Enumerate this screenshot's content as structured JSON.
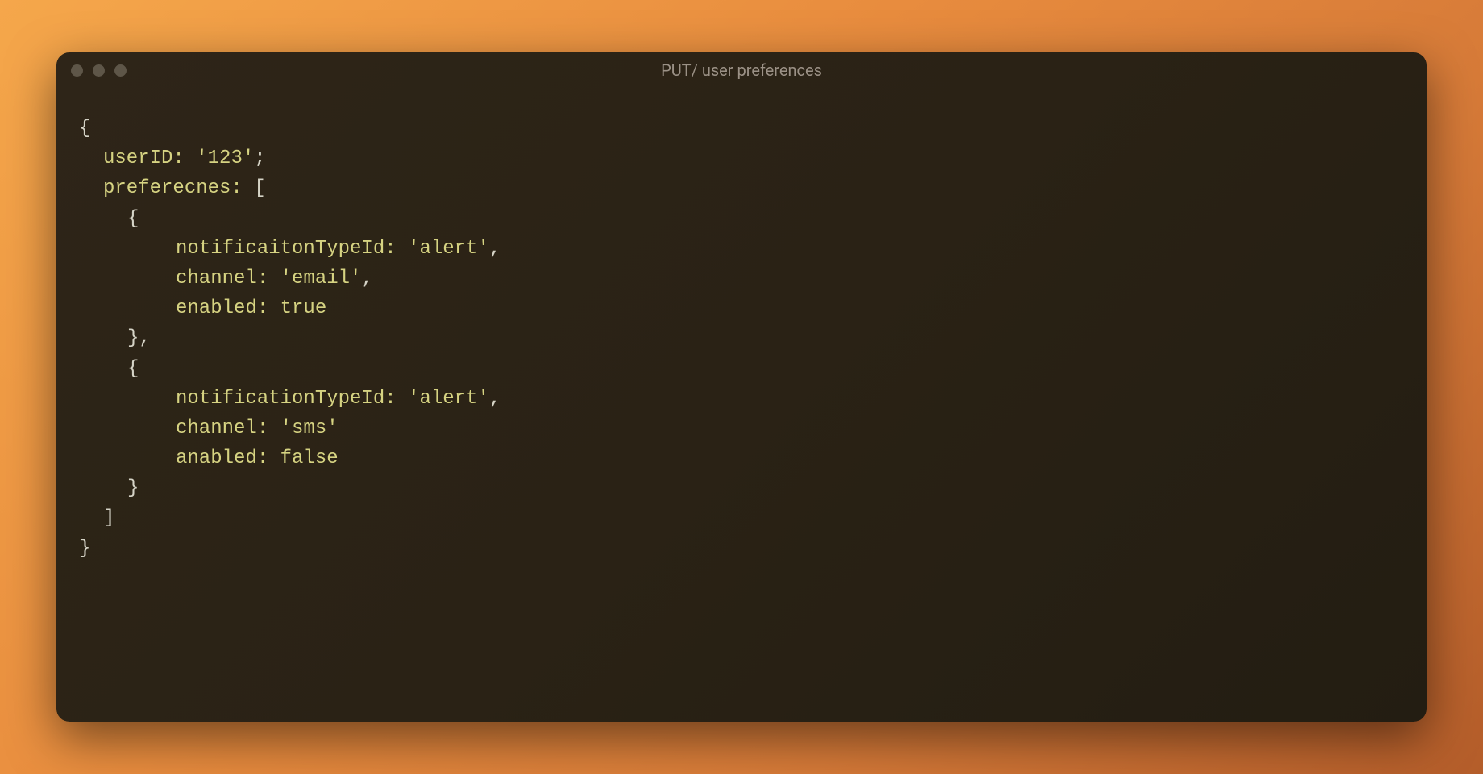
{
  "window": {
    "title": "PUT/ user preferences"
  },
  "code": {
    "line1": "{",
    "line2_key": "userID:",
    "line2_val": "'123'",
    "line2_end": ";",
    "line3_key": "preferecnes:",
    "line3_bracket": " [",
    "line4": "{",
    "line5_key": "notificaitonTypeId:",
    "line5_val": "'alert'",
    "line5_end": ",",
    "line6_key": "channel:",
    "line6_val": "'email'",
    "line6_end": ",",
    "line7_key": "enabled:",
    "line7_val": "true",
    "line8": "},",
    "line9": "{",
    "line10_key": "notificationTypeId:",
    "line10_val": "'alert'",
    "line10_end": ",",
    "line11_key": "channel:",
    "line11_val": "'sms'",
    "line12_key": "anabled:",
    "line12_val": "false",
    "line13": "}",
    "line14": "]",
    "line15": "}"
  }
}
